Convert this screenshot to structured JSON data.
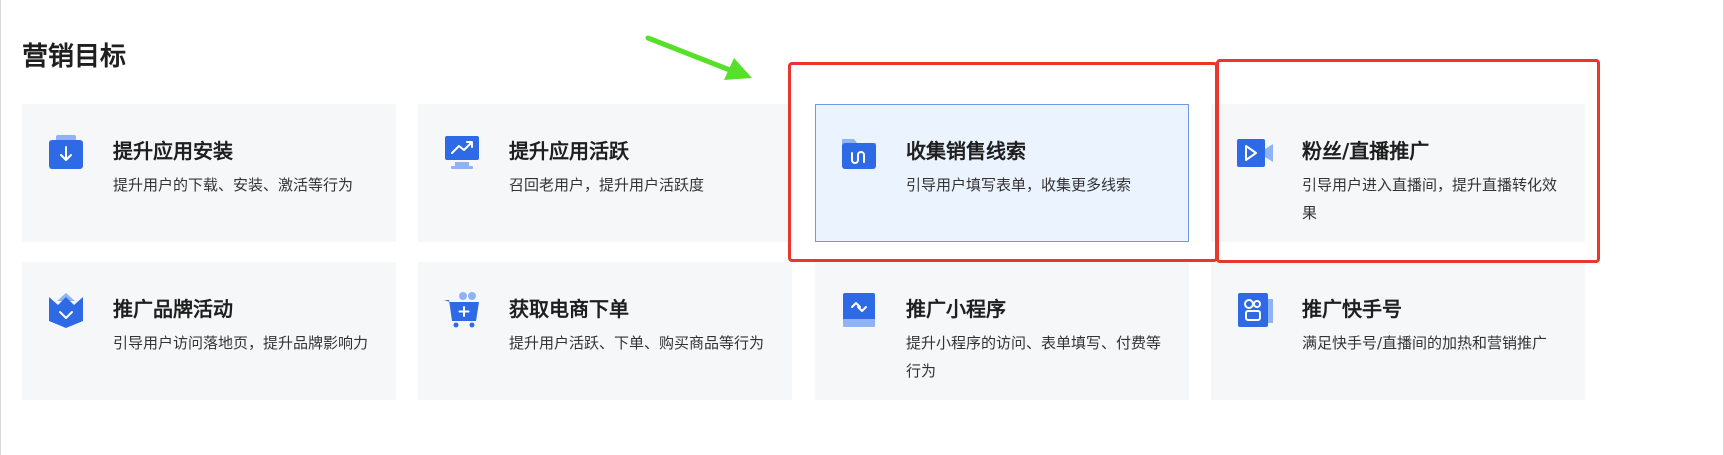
{
  "section_title": "营销目标",
  "colors": {
    "primary": "#2f6ae6",
    "selected_bg": "#ebf3ff",
    "card_bg": "#f6f7f9",
    "highlight_red": "#e8372c",
    "arrow_green": "#57e02a"
  },
  "cards": [
    {
      "title": "提升应用安装",
      "desc": "提升用户的下载、安装、激活等行为",
      "icon": "download-folder-icon"
    },
    {
      "title": "提升应用活跃",
      "desc": "召回老用户，提升用户活跃度",
      "icon": "monitor-trend-icon"
    },
    {
      "title": "收集销售线索",
      "desc": "引导用户填写表单，收集更多线索",
      "icon": "folder-wave-icon",
      "selected": true
    },
    {
      "title": "粉丝/直播推广",
      "desc": "引导用户进入直播间，提升直播转化效果",
      "icon": "video-camera-icon"
    },
    {
      "title": "推广品牌活动",
      "desc": "引导用户访问落地页，提升品牌影响力",
      "icon": "crown-icon"
    },
    {
      "title": "获取电商下单",
      "desc": "提升用户活跃、下单、购买商品等行为",
      "icon": "shopping-cart-icon"
    },
    {
      "title": "推广小程序",
      "desc": "提升小程序的访问、表单填写、付费等行为",
      "icon": "mini-program-icon"
    },
    {
      "title": "推广快手号",
      "desc": "满足快手号/直播间的加热和营销推广",
      "icon": "kuaishou-account-icon"
    }
  ]
}
